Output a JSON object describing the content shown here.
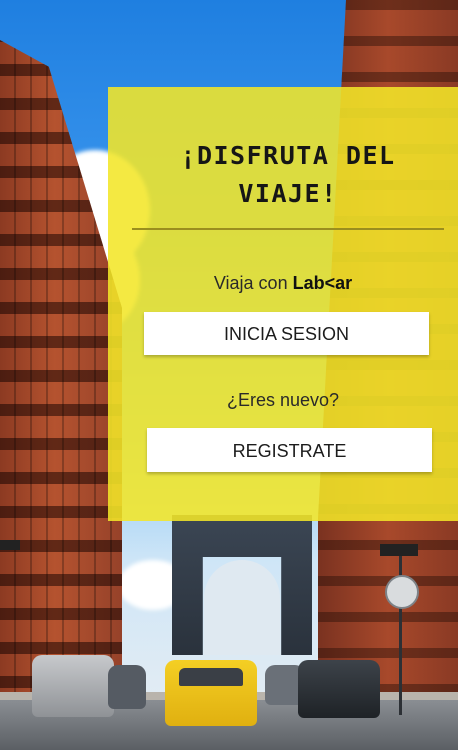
{
  "hero": {
    "title_line1": "¡DISFRUTA DEL",
    "title_line2": "VIAJE!"
  },
  "login_section": {
    "tagline_prefix": "Viaja con ",
    "brand_name": "Lab<ar",
    "login_button": "INICIA SESION"
  },
  "register_section": {
    "question": "¿Eres nuevo?",
    "register_button": "REGISTRATE"
  },
  "theme": {
    "card_color": "#f3e628",
    "button_color": "#ffffff",
    "text_color": "#161616"
  }
}
